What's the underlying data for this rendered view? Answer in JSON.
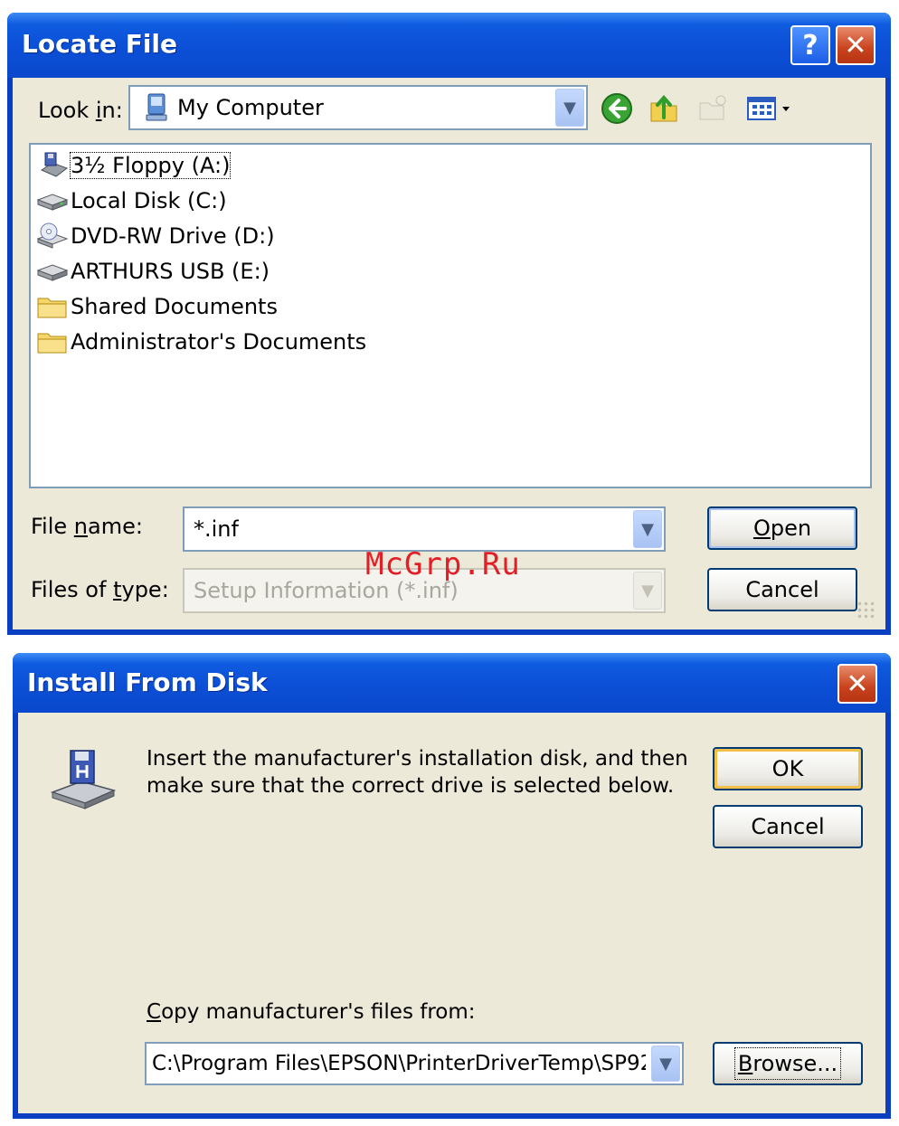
{
  "locate": {
    "title": "Locate File",
    "look_in_label_pre": "Look ",
    "look_in_label_u": "i",
    "look_in_label_post": "n:",
    "look_in_value": "My Computer",
    "items": [
      {
        "label": "3½ Floppy (A:)",
        "icon": "floppy-drive-icon"
      },
      {
        "label": "Local Disk (C:)",
        "icon": "hard-disk-icon"
      },
      {
        "label": "DVD-RW Drive (D:)",
        "icon": "dvd-drive-icon"
      },
      {
        "label": "ARTHURS USB (E:)",
        "icon": "usb-drive-icon"
      },
      {
        "label": "Shared Documents",
        "icon": "folder-icon"
      },
      {
        "label": "Administrator's Documents",
        "icon": "folder-icon"
      }
    ],
    "filename_label_pre": "File ",
    "filename_label_u": "n",
    "filename_label_post": "ame:",
    "filename_value": "*.inf",
    "filetype_label_pre": "Files of ",
    "filetype_label_u": "t",
    "filetype_label_post": "ype:",
    "filetype_value": "Setup Information (*.inf)",
    "open_u": "O",
    "open_rest": "pen",
    "cancel": "Cancel"
  },
  "install": {
    "title": "Install From Disk",
    "message_line1": "Insert the manufacturer's installation disk, and then",
    "message_line2": "make sure that the correct drive is selected below.",
    "ok": "OK",
    "cancel": "Cancel",
    "copy_label_u": "C",
    "copy_label_rest": "opy manufacturer's files from:",
    "path_value": "C:\\Program Files\\EPSON\\PrinterDriverTemp\\SP92",
    "browse_u": "B",
    "browse_rest": "rowse..."
  },
  "watermark": "McGrp.Ru",
  "colors": {
    "titlebar": "#0b4fd6",
    "dialog_bg": "#ece9d8",
    "close_button": "#c8421d",
    "watermark": "#e41e26"
  }
}
